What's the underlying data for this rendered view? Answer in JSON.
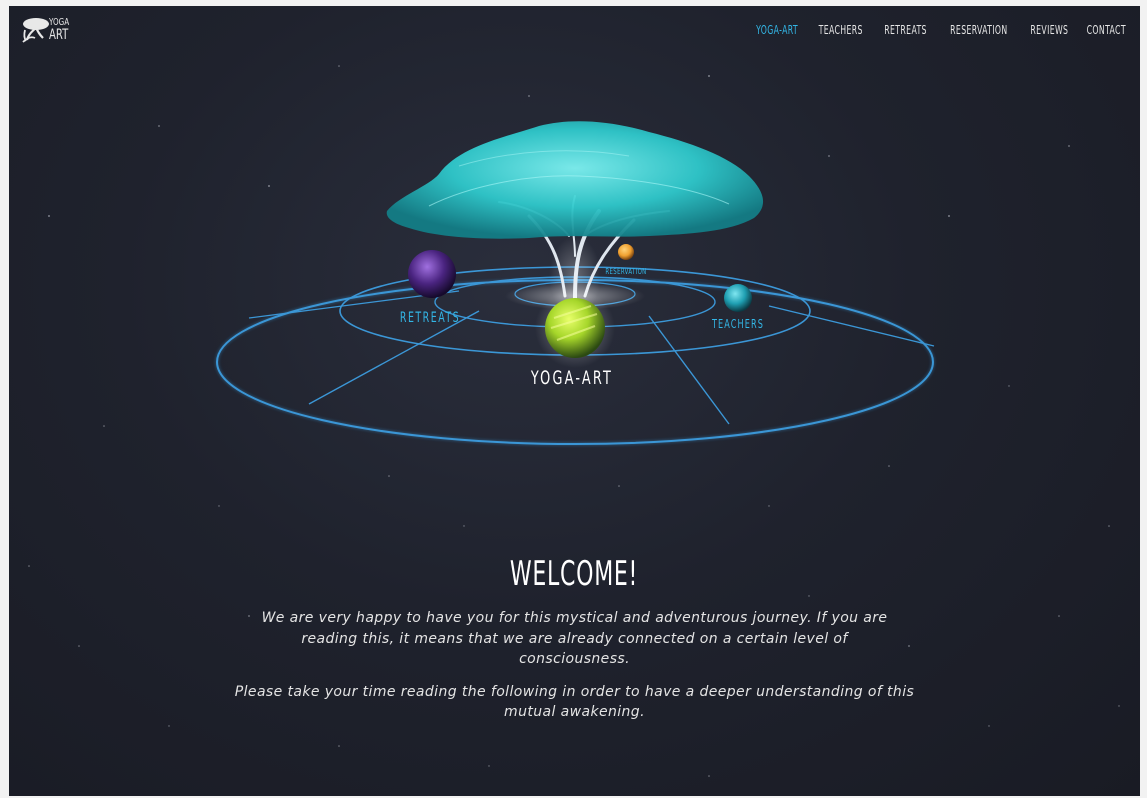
{
  "brand": {
    "logo_top": "YOGA",
    "logo_bottom": "ART"
  },
  "nav": {
    "items": [
      {
        "label": "YOGA-ART",
        "active": true
      },
      {
        "label": "TEACHERS",
        "active": false
      },
      {
        "label": "RETREATS",
        "active": false
      },
      {
        "label": "RESERVATION",
        "active": false
      },
      {
        "label": "REVIEWS",
        "active": false
      },
      {
        "label": "CONTACT",
        "active": false
      }
    ]
  },
  "hero": {
    "planets": {
      "yoga_art": "YOGA-ART",
      "retreats": "RETREATS",
      "teachers": "TEACHERS",
      "reservation": "RESERVATION"
    }
  },
  "welcome": {
    "title": "WELCOME!",
    "paragraph1": "We are very happy to have you for this mystical and adventurous journey. If you are reading this, it means that we are already connected on a certain level of consciousness.",
    "paragraph2": "Please take your time reading the following in order to have a deeper understanding of this mutual awakening."
  },
  "colors": {
    "accent": "#33b6e6",
    "background": "#1f222d",
    "tree_canopy": "#2fd0d0",
    "ring": "#3ea3e8",
    "planet_center": "#a6d62a",
    "planet_retreats": "#5a2c8c",
    "planet_teachers": "#1fa5b8",
    "planet_reservation": "#f0a030"
  }
}
